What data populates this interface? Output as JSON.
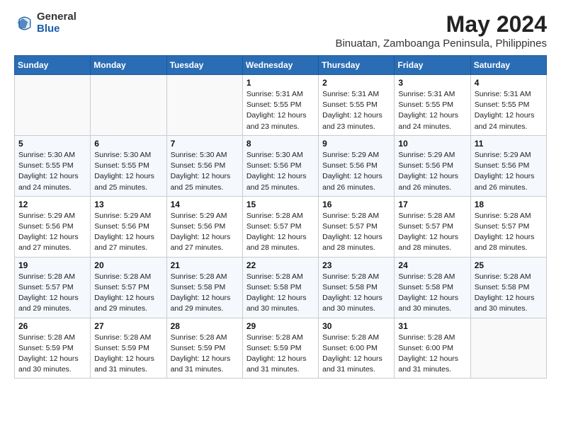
{
  "logo": {
    "general": "General",
    "blue": "Blue"
  },
  "title": {
    "month_year": "May 2024",
    "location": "Binuatan, Zamboanga Peninsula, Philippines"
  },
  "days_of_week": [
    "Sunday",
    "Monday",
    "Tuesday",
    "Wednesday",
    "Thursday",
    "Friday",
    "Saturday"
  ],
  "weeks": [
    [
      {
        "day": "",
        "info": ""
      },
      {
        "day": "",
        "info": ""
      },
      {
        "day": "",
        "info": ""
      },
      {
        "day": "1",
        "info": "Sunrise: 5:31 AM\nSunset: 5:55 PM\nDaylight: 12 hours\nand 23 minutes."
      },
      {
        "day": "2",
        "info": "Sunrise: 5:31 AM\nSunset: 5:55 PM\nDaylight: 12 hours\nand 23 minutes."
      },
      {
        "day": "3",
        "info": "Sunrise: 5:31 AM\nSunset: 5:55 PM\nDaylight: 12 hours\nand 24 minutes."
      },
      {
        "day": "4",
        "info": "Sunrise: 5:31 AM\nSunset: 5:55 PM\nDaylight: 12 hours\nand 24 minutes."
      }
    ],
    [
      {
        "day": "5",
        "info": "Sunrise: 5:30 AM\nSunset: 5:55 PM\nDaylight: 12 hours\nand 24 minutes."
      },
      {
        "day": "6",
        "info": "Sunrise: 5:30 AM\nSunset: 5:55 PM\nDaylight: 12 hours\nand 25 minutes."
      },
      {
        "day": "7",
        "info": "Sunrise: 5:30 AM\nSunset: 5:56 PM\nDaylight: 12 hours\nand 25 minutes."
      },
      {
        "day": "8",
        "info": "Sunrise: 5:30 AM\nSunset: 5:56 PM\nDaylight: 12 hours\nand 25 minutes."
      },
      {
        "day": "9",
        "info": "Sunrise: 5:29 AM\nSunset: 5:56 PM\nDaylight: 12 hours\nand 26 minutes."
      },
      {
        "day": "10",
        "info": "Sunrise: 5:29 AM\nSunset: 5:56 PM\nDaylight: 12 hours\nand 26 minutes."
      },
      {
        "day": "11",
        "info": "Sunrise: 5:29 AM\nSunset: 5:56 PM\nDaylight: 12 hours\nand 26 minutes."
      }
    ],
    [
      {
        "day": "12",
        "info": "Sunrise: 5:29 AM\nSunset: 5:56 PM\nDaylight: 12 hours\nand 27 minutes."
      },
      {
        "day": "13",
        "info": "Sunrise: 5:29 AM\nSunset: 5:56 PM\nDaylight: 12 hours\nand 27 minutes."
      },
      {
        "day": "14",
        "info": "Sunrise: 5:29 AM\nSunset: 5:56 PM\nDaylight: 12 hours\nand 27 minutes."
      },
      {
        "day": "15",
        "info": "Sunrise: 5:28 AM\nSunset: 5:57 PM\nDaylight: 12 hours\nand 28 minutes."
      },
      {
        "day": "16",
        "info": "Sunrise: 5:28 AM\nSunset: 5:57 PM\nDaylight: 12 hours\nand 28 minutes."
      },
      {
        "day": "17",
        "info": "Sunrise: 5:28 AM\nSunset: 5:57 PM\nDaylight: 12 hours\nand 28 minutes."
      },
      {
        "day": "18",
        "info": "Sunrise: 5:28 AM\nSunset: 5:57 PM\nDaylight: 12 hours\nand 28 minutes."
      }
    ],
    [
      {
        "day": "19",
        "info": "Sunrise: 5:28 AM\nSunset: 5:57 PM\nDaylight: 12 hours\nand 29 minutes."
      },
      {
        "day": "20",
        "info": "Sunrise: 5:28 AM\nSunset: 5:57 PM\nDaylight: 12 hours\nand 29 minutes."
      },
      {
        "day": "21",
        "info": "Sunrise: 5:28 AM\nSunset: 5:58 PM\nDaylight: 12 hours\nand 29 minutes."
      },
      {
        "day": "22",
        "info": "Sunrise: 5:28 AM\nSunset: 5:58 PM\nDaylight: 12 hours\nand 30 minutes."
      },
      {
        "day": "23",
        "info": "Sunrise: 5:28 AM\nSunset: 5:58 PM\nDaylight: 12 hours\nand 30 minutes."
      },
      {
        "day": "24",
        "info": "Sunrise: 5:28 AM\nSunset: 5:58 PM\nDaylight: 12 hours\nand 30 minutes."
      },
      {
        "day": "25",
        "info": "Sunrise: 5:28 AM\nSunset: 5:58 PM\nDaylight: 12 hours\nand 30 minutes."
      }
    ],
    [
      {
        "day": "26",
        "info": "Sunrise: 5:28 AM\nSunset: 5:59 PM\nDaylight: 12 hours\nand 30 minutes."
      },
      {
        "day": "27",
        "info": "Sunrise: 5:28 AM\nSunset: 5:59 PM\nDaylight: 12 hours\nand 31 minutes."
      },
      {
        "day": "28",
        "info": "Sunrise: 5:28 AM\nSunset: 5:59 PM\nDaylight: 12 hours\nand 31 minutes."
      },
      {
        "day": "29",
        "info": "Sunrise: 5:28 AM\nSunset: 5:59 PM\nDaylight: 12 hours\nand 31 minutes."
      },
      {
        "day": "30",
        "info": "Sunrise: 5:28 AM\nSunset: 6:00 PM\nDaylight: 12 hours\nand 31 minutes."
      },
      {
        "day": "31",
        "info": "Sunrise: 5:28 AM\nSunset: 6:00 PM\nDaylight: 12 hours\nand 31 minutes."
      },
      {
        "day": "",
        "info": ""
      }
    ]
  ]
}
